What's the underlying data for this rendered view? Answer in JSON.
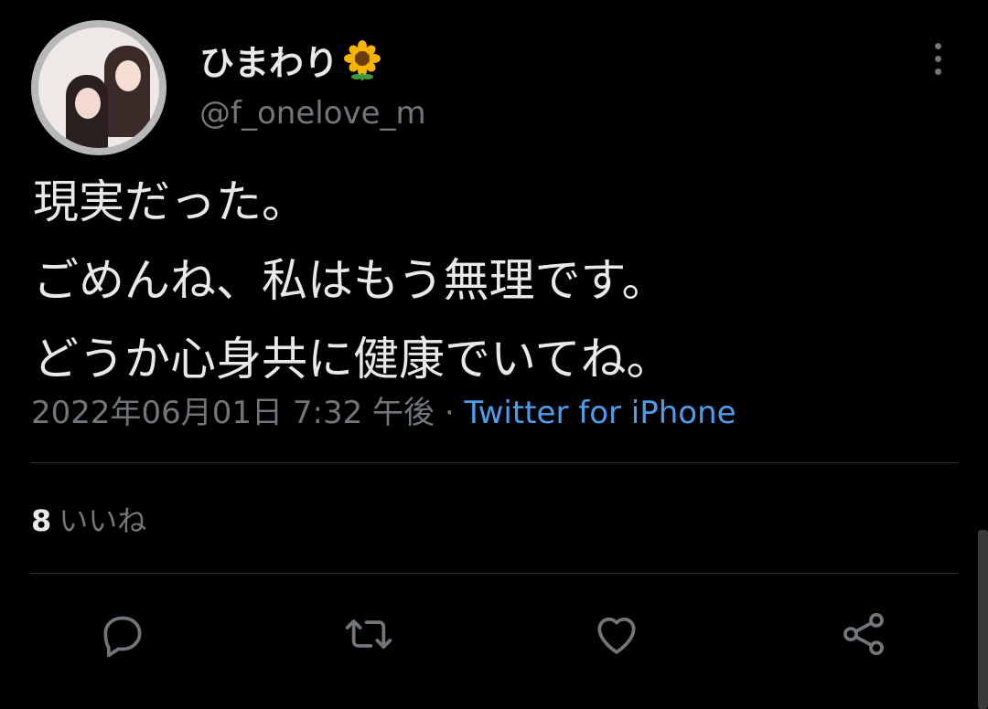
{
  "tweet": {
    "author": {
      "display_name": "ひまわり",
      "display_name_emoji": "sunflower-emoji",
      "handle": "@f_onelove_m"
    },
    "text_lines": [
      "現実だった。",
      "ごめんね、私はもう無理です。",
      "どうか心身共に健康でいてね。"
    ],
    "timestamp": "2022年06月01日 7:32 午後",
    "separator": " · ",
    "source": "Twitter for iPhone",
    "likes": {
      "count": "8",
      "label": "いいね"
    }
  },
  "actions": {
    "reply": "reply-icon",
    "retweet": "retweet-icon",
    "like": "heart-icon",
    "share": "share-icon"
  },
  "colors": {
    "background": "#000000",
    "text": "#e7e9ea",
    "muted": "#71767b",
    "link": "#4c9eea",
    "divider": "#2f3336"
  }
}
